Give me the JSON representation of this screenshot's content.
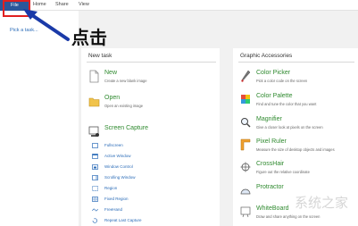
{
  "menu": [
    {
      "label": "File"
    },
    {
      "label": "Home"
    },
    {
      "label": "Share"
    },
    {
      "label": "View"
    }
  ],
  "left_pane": {
    "pick_task": "Pick a task..."
  },
  "annotation": {
    "text": "点击",
    "arrow_color": "#1a3aa8",
    "highlight_color": "#e02020"
  },
  "new_task": {
    "title": "New task",
    "items": [
      {
        "title": "New",
        "desc": "Create a new blank image",
        "icon": "new-document-icon"
      },
      {
        "title": "Open",
        "desc": "Open an existing image",
        "icon": "open-folder-icon"
      },
      {
        "title": "Screen Capture",
        "desc": "",
        "icon": "screen-capture-icon"
      }
    ],
    "capture_options": [
      {
        "label": "Fullscreen",
        "icon": "fullscreen-icon"
      },
      {
        "label": "Active Window",
        "icon": "active-window-icon"
      },
      {
        "label": "Window Control",
        "icon": "window-control-icon"
      },
      {
        "label": "Scrolling Window",
        "icon": "scrolling-window-icon"
      },
      {
        "label": "Region",
        "icon": "region-icon"
      },
      {
        "label": "Fixed Region",
        "icon": "fixed-region-icon"
      },
      {
        "label": "FreeHand",
        "icon": "freehand-icon"
      },
      {
        "label": "Repeat Last Capture",
        "icon": "repeat-capture-icon"
      }
    ]
  },
  "graphic_accessories": {
    "title": "Graphic Accessories",
    "items": [
      {
        "title": "Color Picker",
        "desc": "Pick a color code on the screen",
        "icon": "color-picker-icon"
      },
      {
        "title": "Color Palette",
        "desc": "Find and tune the color that you want",
        "icon": "color-palette-icon"
      },
      {
        "title": "Magnifier",
        "desc": "Give a closer look at pixels on the screen",
        "icon": "magnifier-icon"
      },
      {
        "title": "Pixel Ruler",
        "desc": "Measure the size of desktop objects and images",
        "icon": "pixel-ruler-icon"
      },
      {
        "title": "CrossHair",
        "desc": "Figure out the relative coordinate",
        "icon": "crosshair-icon"
      },
      {
        "title": "Protractor",
        "desc": "",
        "icon": "protractor-icon"
      },
      {
        "title": "WhiteBoard",
        "desc": "Draw and share anything on the screen",
        "icon": "whiteboard-icon"
      }
    ]
  },
  "colors": {
    "accent_green": "#2f8a2f",
    "link_blue": "#2b6cb8",
    "file_tab": "#2b579a"
  },
  "watermark": "系统之家"
}
